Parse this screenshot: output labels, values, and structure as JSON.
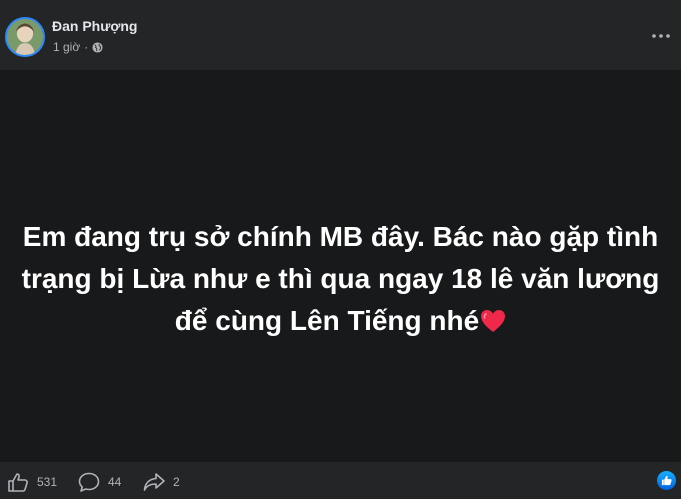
{
  "post": {
    "author": "Đan Phượng",
    "timestamp": "1 giờ",
    "separator": "·",
    "privacy_icon": "globe-icon",
    "status_text": "Em đang trụ sở chính MB đây. Bác nào gặp tình trạng bị Lừa như e thì qua ngay 18 lê văn lương để cùng Lên Tiếng nhé",
    "emoji": "heart-emoji"
  },
  "actions": {
    "like_count": "531",
    "comment_count": "44",
    "share_count": "2"
  },
  "colors": {
    "background": "#242526",
    "status_background": "#18191a",
    "heart": "#f02849",
    "like_badge": "#1877f2"
  }
}
